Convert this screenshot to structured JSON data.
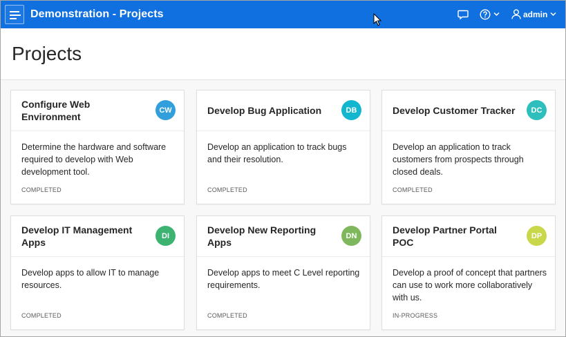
{
  "header": {
    "app_title": "Demonstration - Projects",
    "user_name": "admin"
  },
  "page": {
    "title": "Projects"
  },
  "cards": [
    {
      "title": "Configure Web Environment",
      "initials": "CW",
      "color": "#309fdb",
      "description": "Determine the hardware and software required to develop with Web development tool.",
      "status": "COMPLETED"
    },
    {
      "title": "Develop Bug Application",
      "initials": "DB",
      "color": "#13b6cf",
      "description": "Develop an application to track bugs and their resolution.",
      "status": "COMPLETED"
    },
    {
      "title": "Develop Customer Tracker",
      "initials": "DC",
      "color": "#2ebfbc",
      "description": "Develop an application to track customers from prospects through closed deals.",
      "status": "COMPLETED"
    },
    {
      "title": "Develop IT Management Apps",
      "initials": "DI",
      "color": "#3cb371",
      "description": "Develop apps to allow IT to manage resources.",
      "status": "COMPLETED"
    },
    {
      "title": "Develop New Reporting Apps",
      "initials": "DN",
      "color": "#7fb85c",
      "description": "Develop apps to meet C Level reporting requirements.",
      "status": "COMPLETED"
    },
    {
      "title": "Develop Partner Portal POC",
      "initials": "DP",
      "color": "#c8d84a",
      "description": "Develop a proof of concept that partners can use to work more collaboratively with us.",
      "status": "IN-PROGRESS"
    }
  ],
  "icons": {
    "menu": "hamburger-menu-icon",
    "feedback": "chat-bubble-icon",
    "help": "help-circle-icon",
    "user": "user-icon",
    "chevron": "chevron-down-icon"
  },
  "colors": {
    "header_bg": "#1070e0",
    "page_bg": "#f8f8f8"
  }
}
